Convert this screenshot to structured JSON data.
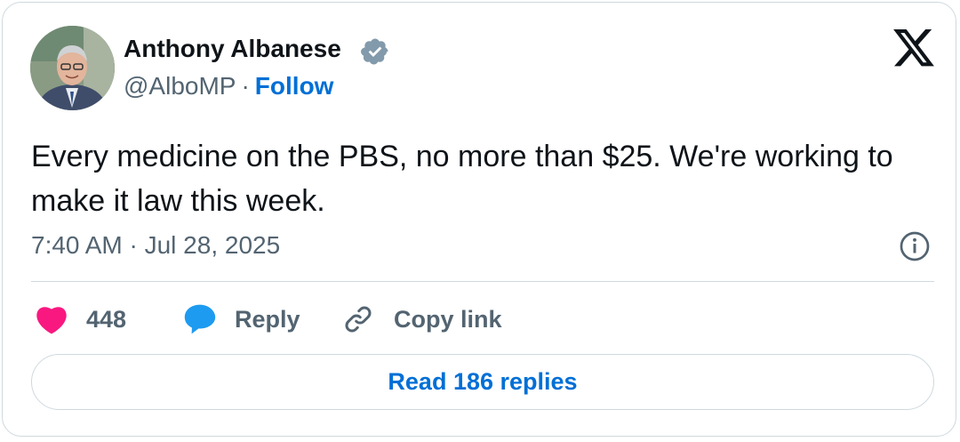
{
  "author": {
    "name": "Anthony Albanese",
    "handle": "@AlboMP",
    "separator": "·",
    "follow_label": "Follow",
    "verified_icon": "verified-badge-icon"
  },
  "platform_logo": "x-logo-icon",
  "tweet": {
    "text": "Every medicine on the PBS, no more than $25. We're working to make it law this week.",
    "timestamp": "7:40 AM · Jul 28, 2025"
  },
  "actions": {
    "like_count": "448",
    "reply_label": "Reply",
    "copy_label": "Copy link"
  },
  "read_replies_label": "Read 186 replies",
  "colors": {
    "accent": "#006fd6",
    "like": "#f91880",
    "reply": "#1d9bf0",
    "secondary_text": "#536471",
    "verified": "#829aab"
  }
}
